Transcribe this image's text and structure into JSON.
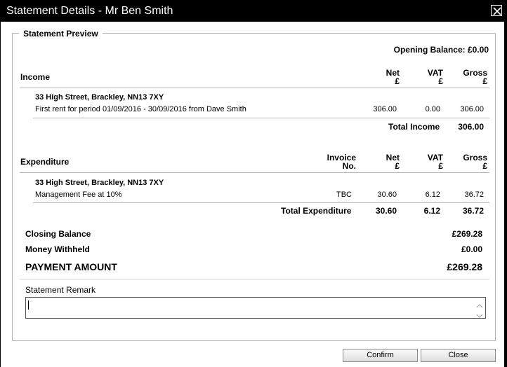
{
  "window": {
    "title": "Statement Details - Mr Ben Smith"
  },
  "preview": {
    "legend": "Statement Preview",
    "opening_balance": "Opening Balance: £0.00"
  },
  "income": {
    "title": "Income",
    "col_net": "Net",
    "col_vat": "VAT",
    "col_gross": "Gross",
    "currency": "£",
    "property": "33 High Street, Brackley, NN13 7XY",
    "item": {
      "description": "First rent for period 01/09/2016 - 30/09/2016 from Dave Smith",
      "net": "306.00",
      "vat": "0.00",
      "gross": "306.00"
    },
    "total_label": "Total Income",
    "total_gross": "306.00"
  },
  "expenditure": {
    "title": "Expenditure",
    "col_invoice_1": "Invoice",
    "col_invoice_2": "No.",
    "col_net": "Net",
    "col_vat": "VAT",
    "col_gross": "Gross",
    "currency": "£",
    "property": "33 High Street, Brackley, NN13 7XY",
    "item": {
      "description": "Management Fee at 10%",
      "invoice": "TBC",
      "net": "30.60",
      "vat": "6.12",
      "gross": "36.72"
    },
    "total_label": "Total Expenditure",
    "total_net": "30.60",
    "total_vat": "6.12",
    "total_gross": "36.72"
  },
  "summary": {
    "closing_label": "Closing Balance",
    "closing_value": "£269.28",
    "withheld_label": "Money Withheld",
    "withheld_value": "£0.00",
    "payment_label": "PAYMENT AMOUNT",
    "payment_value": "£269.28"
  },
  "remark": {
    "label": "Statement Remark",
    "value": ""
  },
  "buttons": {
    "confirm": "Confirm",
    "close": "Close"
  },
  "icons": {
    "close": "close-x-icon",
    "scroll_up": "chevron-up-icon",
    "scroll_down": "chevron-down-icon"
  }
}
